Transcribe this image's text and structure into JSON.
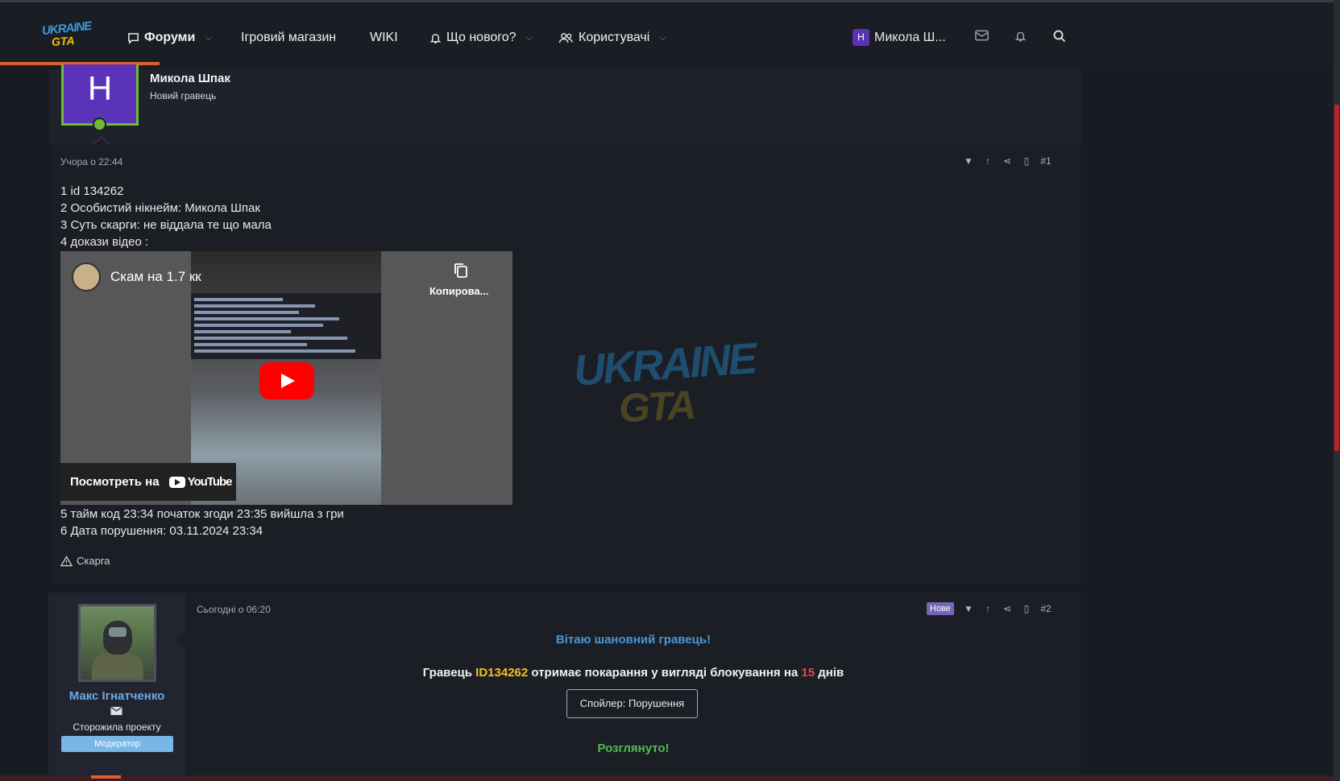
{
  "logo": {
    "line1": "UKRAINE",
    "line2": "GTA"
  },
  "nav": {
    "forums": "Форуми",
    "shop": "Ігровий магазин",
    "wiki": "WIKI",
    "whats_new": "Що нового?",
    "users": "Користувачі"
  },
  "user_menu": {
    "avatar_letter": "Н",
    "name": "Микола Ш..."
  },
  "post1": {
    "avatar_letter": "Н",
    "username": "Микола Шпак",
    "user_title": "Новий гравець",
    "date": "Учора о 22:44",
    "number": "#1",
    "lines": [
      "1 id 134262",
      "2 Особистий нікнейм: Микола Шпак",
      "3 Суть скарги: не віддала те що мала",
      "4 докази відео :"
    ],
    "video": {
      "title": "Скам на 1.7 кк",
      "copy_label": "Копирова...",
      "watch_label": "Посмотреть на",
      "yt_label": "YouTube"
    },
    "lines_after": [
      "5 тайм код 23:34 початок згоди 23:35 вийшла з гри",
      "6 Дата порушення: 03.11.2024 23:34"
    ],
    "report_label": "Скарга"
  },
  "watermark": {
    "line1": "UKRAINE",
    "line2": "GTA"
  },
  "post2": {
    "username": "Макс Ігнатченко",
    "user_title": "Сторожила проекту",
    "role_badge": "Модератор",
    "date": "Сьогодні о 06:20",
    "new_badge": "Нове",
    "number": "#2",
    "greeting": "Вітаю шановний гравець!",
    "verdict_prefix": "Гравець ",
    "verdict_id": "ID134262",
    "verdict_mid": " отримає покарання у вигляді блокування на ",
    "verdict_days": "15",
    "verdict_suffix": " днів",
    "spoiler": "Спойлер: Порушення",
    "status": "Розглянуто!"
  },
  "colors": {
    "accent_orange": "#e25d2e",
    "greeting_blue": "#4797d5",
    "id_yellow": "#f2c11c",
    "days_red": "#e04848",
    "status_green": "#4fbf4f",
    "moderator_badge": "#78b6e6"
  }
}
